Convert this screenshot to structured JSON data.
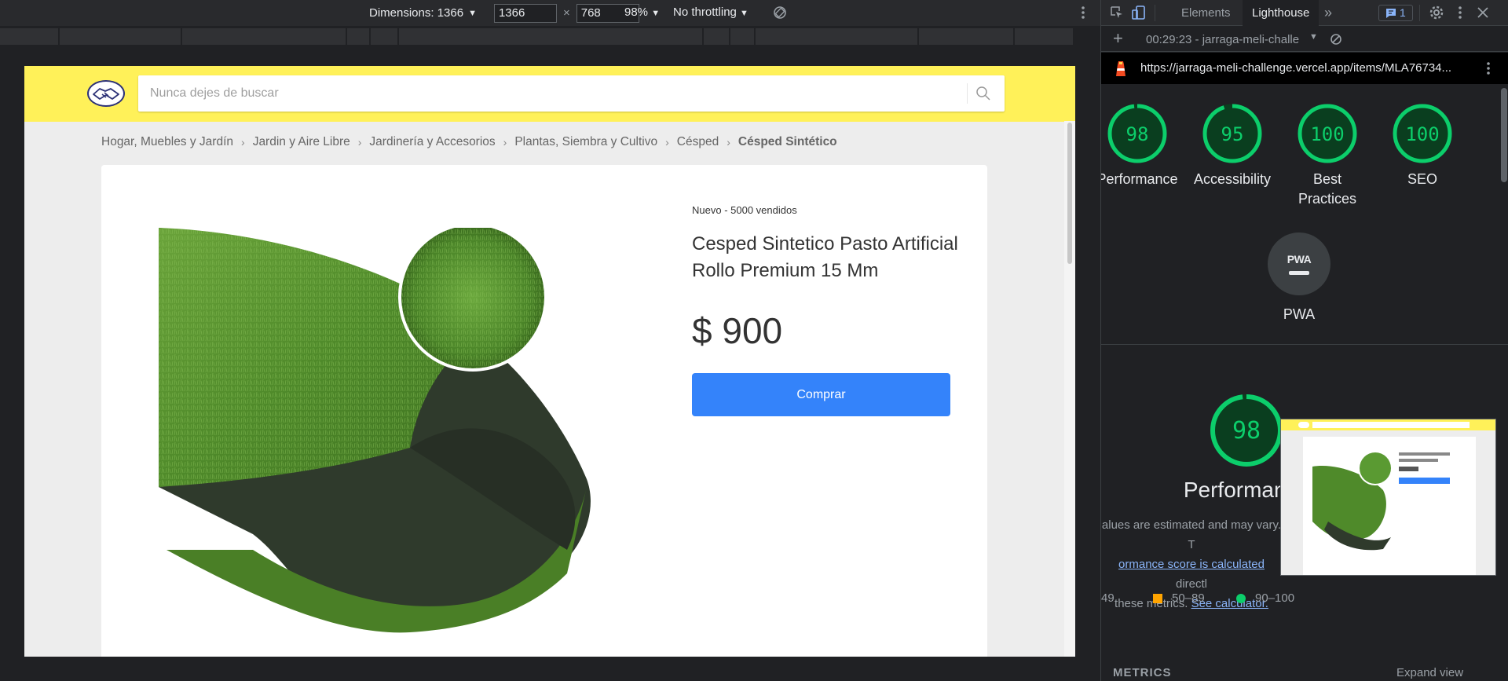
{
  "emulation_toolbar": {
    "dimensions_label": "Dimensions: 1366",
    "width_value": "1366",
    "height_value": "768",
    "times": "×",
    "zoom": "98%",
    "throttling": "No throttling"
  },
  "page": {
    "search": {
      "placeholder": "Nunca dejes de buscar"
    },
    "breadcrumb": [
      "Hogar, Muebles y Jardín",
      "Jardin y Aire Libre",
      "Jardinería y Accesorios",
      "Plantas, Siembra y Cultivo",
      "Césped"
    ],
    "breadcrumb_current": "Césped Sintético",
    "product": {
      "condition": "Nuevo - 5000 vendidos",
      "title": "Cesped Sintetico Pasto Artificial Rollo Premium 15 Mm",
      "price": "$ 900",
      "buy_label": "Comprar"
    }
  },
  "devtools": {
    "tabs": [
      "Elements",
      "Lighthouse"
    ],
    "active_tab": "Lighthouse",
    "issues_count": "1",
    "run_label": "00:29:23 - jarraga-meli-challe",
    "url": "https://jarraga-meli-challenge.vercel.app/items/MLA76734...",
    "scores": [
      {
        "label": "Performance",
        "value": "98",
        "score": 98
      },
      {
        "label": "Accessibility",
        "value": "95",
        "score": 95
      },
      {
        "label": "Best Practices",
        "value": "100",
        "score": 100
      },
      {
        "label": "SEO",
        "value": "100",
        "score": 100
      }
    ],
    "pwa_label": "PWA",
    "pwa_logo": "PWA",
    "performance": {
      "score": "98",
      "score_fraction": 0.98,
      "title": "Performance",
      "note_1": "alues are estimated and may vary. T",
      "note_link_1": "ormance score is calculated",
      "note_2": " directl",
      "note_3": "these metrics. ",
      "note_link_2": "See calculator."
    },
    "legend": {
      "fail": "49",
      "average": "50–89",
      "pass": "90–100"
    },
    "metrics_heading": "METRICS",
    "expand_label": "Expand view",
    "colors": {
      "pass": "#0cce6b",
      "average": "#ffa400",
      "accent": "#8ab4f8"
    }
  }
}
